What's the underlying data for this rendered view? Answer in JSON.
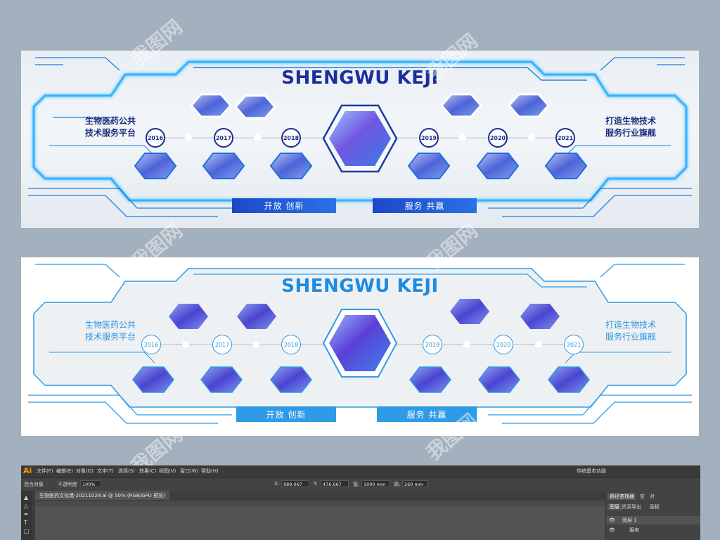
{
  "variants": [
    {
      "title": "SHENGWU KEJI",
      "left_text": [
        "生物医药公共",
        "技术服务平台"
      ],
      "right_text": [
        "打造生物技术",
        "服务行业旗舰"
      ],
      "years": [
        "2016",
        "2017",
        "2018",
        "2019",
        "2020",
        "2021"
      ],
      "buttons": [
        "开放  创新",
        "服务  共赢"
      ],
      "colors": {
        "title": "#1c2f9c",
        "line": "#1f7fe0",
        "glow": "#35b4ff"
      }
    },
    {
      "title": "SHENGWU KEJI",
      "left_text": [
        "生物医药公共",
        "技术服务平台"
      ],
      "right_text": [
        "打造生物技术",
        "服务行业旗舰"
      ],
      "years": [
        "2016",
        "2017",
        "2018",
        "2019",
        "2020",
        "2021"
      ],
      "buttons": [
        "开放  创新",
        "服务  共赢"
      ],
      "colors": {
        "title": "#1d8be0",
        "line": "#2f9ae5"
      }
    }
  ],
  "illustrator": {
    "logo": "Ai",
    "menu": [
      "文件(F)",
      "编辑(E)",
      "对象(O)",
      "文字(T)",
      "选择(S)",
      "效果(C)",
      "视图(V)",
      "窗口(W)",
      "帮助(H)"
    ],
    "workspace": "传统基本功能",
    "control": {
      "selection": "混合对象",
      "opacity_label": "不透明度",
      "opacity_value": "100%",
      "x": "989.067",
      "y": "476.667",
      "w": "1000 mm",
      "h": "260 mm"
    },
    "doc_tab": "生物医药文化墙-20211029.ai @ 50% (RGB/GPU 预览)",
    "panel_tabs": [
      "图层",
      "资源导出",
      "画板"
    ],
    "panel_tabs2": [
      "路径查找器",
      "变",
      "对"
    ],
    "layers": [
      "图层 1",
      "服务"
    ]
  },
  "watermark": "我图网"
}
